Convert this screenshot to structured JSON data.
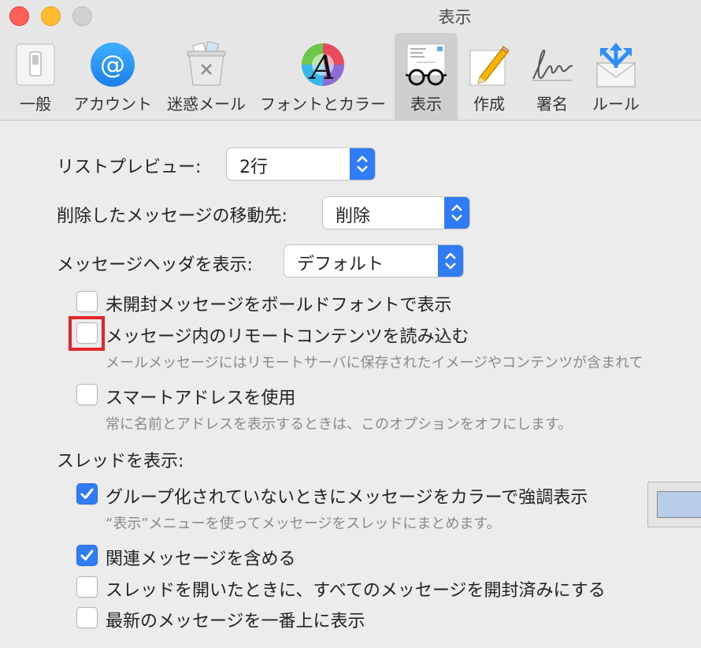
{
  "window": {
    "title": "表示"
  },
  "toolbar": {
    "items": [
      {
        "label": "一般",
        "icon": "general-switch-icon"
      },
      {
        "label": "アカウント",
        "icon": "at-sign-icon"
      },
      {
        "label": "迷惑メール",
        "icon": "junk-trash-icon"
      },
      {
        "label": "フォントとカラー",
        "icon": "font-color-icon"
      },
      {
        "label": "表示",
        "icon": "viewing-glasses-icon",
        "selected": true
      },
      {
        "label": "作成",
        "icon": "compose-pencil-icon"
      },
      {
        "label": "署名",
        "icon": "signature-icon"
      },
      {
        "label": "ルール",
        "icon": "rules-envelope-icon"
      }
    ]
  },
  "settings": {
    "list_preview": {
      "label": "リストプレビュー:",
      "value": "2行"
    },
    "move_deleted": {
      "label": "削除したメッセージの移動先:",
      "value": "削除"
    },
    "header_display": {
      "label": "メッセージヘッダを表示:",
      "value": "デフォルト"
    },
    "bold_unread": {
      "label": "未開封メッセージをボールドフォントで表示",
      "checked": false
    },
    "load_remote": {
      "label": "メッセージ内のリモートコンテンツを読み込む",
      "checked": false,
      "description": "メールメッセージにはリモートサーバに保存されたイメージやコンテンツが含まれて"
    },
    "smart_address": {
      "label": "スマートアドレスを使用",
      "checked": false,
      "description": "常に名前とアドレスを表示するときは、このオプションをオフにします。"
    },
    "thread_section": {
      "label": "スレッドを表示:"
    },
    "color_highlight": {
      "label": "グループ化されていないときにメッセージをカラーで強調表示",
      "checked": true,
      "description": "“表示”メニューを使ってメッセージをスレッドにまとめます。",
      "color": "#b7cdea"
    },
    "include_related": {
      "label": "関連メッセージを含める",
      "checked": true
    },
    "mark_read": {
      "label": "スレッドを開いたときに、すべてのメッセージを開封済みにする",
      "checked": false
    },
    "newest_top": {
      "label": "最新のメッセージを一番上に表示",
      "checked": false
    }
  },
  "colors": {
    "accent": "#2f7cf5",
    "highlight_marker": "#e2262a"
  }
}
